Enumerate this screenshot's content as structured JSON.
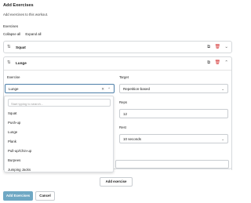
{
  "dialog": {
    "title": "Add Exercises",
    "subtitle": "Add exercises to this workout.",
    "section_label": "Exercises",
    "collapse_all": "Collapse all",
    "expand_all": "Expand all"
  },
  "exercises": [
    {
      "name": "Squat",
      "expanded": false
    },
    {
      "name": "Lunge",
      "expanded": true
    }
  ],
  "form": {
    "exercise_label": "Exercise",
    "exercise_value": "Lunge",
    "target_label": "Target",
    "target_value": "Repetition-based",
    "reps_label": "Reps",
    "reps_value": "12",
    "rest_label": "Rest",
    "rest_value": "10 seconds"
  },
  "dropdown": {
    "search_placeholder": "Start typing to search...",
    "options": [
      "Squat",
      "Push-up",
      "Lunge",
      "Plank",
      "Pull-up/Chin-up",
      "Burpees",
      "Jumping Jacks"
    ]
  },
  "buttons": {
    "add_exercise": "Add exercise",
    "primary": "Add Exercises",
    "cancel": "Cancel"
  },
  "colors": {
    "primary": "#6fa8c4",
    "delete": "#d32f2f",
    "focus_border": "#4d7ea8"
  }
}
